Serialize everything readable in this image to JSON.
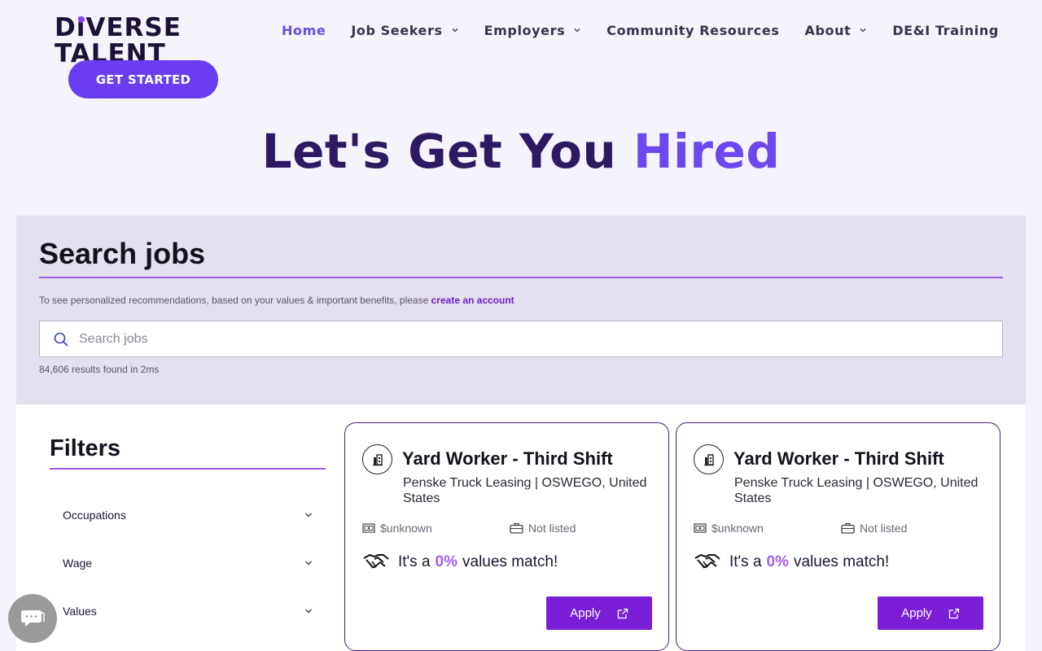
{
  "logo": {
    "line1_a": "D",
    "line1_i": "i",
    "line1_b": "VERSE",
    "line2": "TALENT"
  },
  "header": {
    "cta_label": "GET STARTED"
  },
  "nav": [
    {
      "label": "Home",
      "active": true,
      "dropdown": false
    },
    {
      "label": "Job Seekers",
      "active": false,
      "dropdown": true
    },
    {
      "label": "Employers",
      "active": false,
      "dropdown": true
    },
    {
      "label": "Community Resources",
      "active": false,
      "dropdown": false
    },
    {
      "label": "About",
      "active": false,
      "dropdown": true
    },
    {
      "label": "DE&I Training",
      "active": false,
      "dropdown": false
    }
  ],
  "hero": {
    "text": "Let's Get You ",
    "accent": "Hired"
  },
  "search": {
    "title": "Search jobs",
    "note_prefix": "To see personalized recommendations, based on your values & important benefits, please ",
    "note_link": "create an account",
    "placeholder": "Search jobs",
    "value": "",
    "results": "84,606 results found in 2ms"
  },
  "filters": {
    "title": "Filters",
    "items": [
      {
        "label": "Occupations"
      },
      {
        "label": "Wage"
      },
      {
        "label": "Values"
      }
    ]
  },
  "jobs": [
    {
      "title": "Yard Worker - Third Shift",
      "company": "Penske Truck Leasing | OSWEGO, United States",
      "wage": "$unknown",
      "job_type": "Not listed",
      "match_prefix": "It's a",
      "match_pct": "0%",
      "match_suffix": "values match!",
      "apply_label": "Apply"
    },
    {
      "title": "Yard Worker - Third Shift",
      "company": "Penske Truck Leasing | OSWEGO, United States",
      "wage": "$unknown",
      "job_type": "Not listed",
      "match_prefix": "It's a",
      "match_pct": "0%",
      "match_suffix": "values match!",
      "apply_label": "Apply"
    }
  ],
  "colors": {
    "brand": "#6a3df0",
    "accent_text": "#6d48ee",
    "rule": "#9b5de5",
    "apply": "#7a1fd6",
    "match_pct": "#a65ee8"
  },
  "icons": {
    "search": "search-icon",
    "chevron": "chevron-down-icon",
    "company": "building-icon",
    "wage": "money-icon",
    "job_type": "briefcase-icon",
    "match": "handshake-icon",
    "external": "external-link-icon",
    "chat": "chat-icon"
  }
}
